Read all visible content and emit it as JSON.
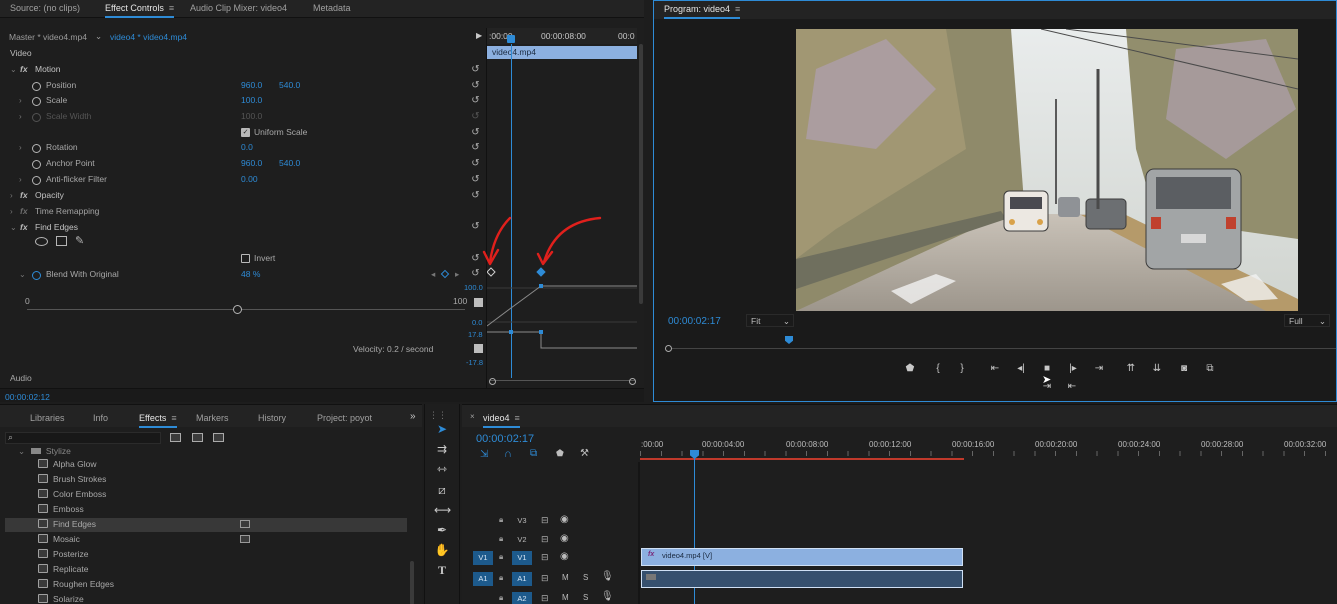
{
  "effect_controls": {
    "tabs": [
      {
        "label": "Source: (no clips)"
      },
      {
        "label": "Effect Controls"
      },
      {
        "label": "Audio Clip Mixer: video4"
      },
      {
        "label": "Metadata"
      }
    ],
    "master_label": "Master * video4.mp4",
    "clip_selector": "video4 * video4.mp4",
    "section_video": "Video",
    "ruler": {
      "start": ":00:00",
      "mid": "00:00:08:00",
      "end": "00:0"
    },
    "clip_bar_label": "video4.mp4",
    "motion": {
      "name": "Motion",
      "position": {
        "label": "Position",
        "x": "960.0",
        "y": "540.0"
      },
      "scale": {
        "label": "Scale",
        "value": "100.0"
      },
      "scale_width": {
        "label": "Scale Width",
        "value": "100.0"
      },
      "uniform_scale": {
        "label": "Uniform Scale",
        "checked": true
      },
      "rotation": {
        "label": "Rotation",
        "value": "0.0"
      },
      "anchor_point": {
        "label": "Anchor Point",
        "x": "960.0",
        "y": "540.0"
      },
      "anti_flicker": {
        "label": "Anti-flicker Filter",
        "value": "0.00"
      }
    },
    "opacity": {
      "name": "Opacity"
    },
    "time_remapping": {
      "name": "Time Remapping"
    },
    "find_edges": {
      "name": "Find Edges",
      "invert_label": "Invert",
      "blend": {
        "label": "Blend With Original",
        "value": "48 %",
        "slider_min": "0",
        "slider_max": "100",
        "slider_fraction": 0.48
      },
      "graph_labels": {
        "top": "100.0",
        "zero": "0.0",
        "vel_top": "17.8",
        "vel_bottom": "-17.8"
      },
      "velocity": "Velocity: 0.2 / second"
    },
    "audio_section": "Audio",
    "timecode": "00:00:02:12"
  },
  "program": {
    "title": "Program: video4",
    "timecode": "00:00:02:17",
    "fit": "Fit",
    "quality": "Full",
    "playhead_fraction": 0.18
  },
  "effects_panel": {
    "tabs": [
      {
        "label": "Libraries"
      },
      {
        "label": "Info"
      },
      {
        "label": "Effects"
      },
      {
        "label": "Markers"
      },
      {
        "label": "History"
      },
      {
        "label": "Project: poyot"
      }
    ],
    "folder": "Stylize",
    "items": [
      {
        "label": "Alpha Glow"
      },
      {
        "label": "Brush Strokes"
      },
      {
        "label": "Color Emboss"
      },
      {
        "label": "Emboss"
      },
      {
        "label": "Find Edges"
      },
      {
        "label": "Mosaic"
      },
      {
        "label": "Posterize"
      },
      {
        "label": "Replicate"
      },
      {
        "label": "Roughen Edges"
      },
      {
        "label": "Solarize"
      }
    ],
    "selected_index": 4
  },
  "timeline": {
    "tab_label": "video4",
    "timecode": "00:00:02:17",
    "ruler": [
      ":00:00",
      "00:00:04:00",
      "00:00:08:00",
      "00:00:12:00",
      "00:00:16:00",
      "00:00:20:00",
      "00:00:24:00",
      "00:00:28:00",
      "00:00:32:00"
    ],
    "tracks": {
      "v3": "V3",
      "v2": "V2",
      "v1_src": "V1",
      "v1": "V1",
      "a1_src": "A1",
      "a1": "A1",
      "a2": "A2"
    },
    "m_label": "M",
    "s_label": "S",
    "clip_label": "video4.mp4 [V]",
    "fx_badge": "fx"
  },
  "colors": {
    "accent": "#2e8bd6",
    "clip_video": "#8cb0e0",
    "clip_audio": "#36506e",
    "work_area": "#c0392b",
    "annotation": "#e0201c"
  }
}
